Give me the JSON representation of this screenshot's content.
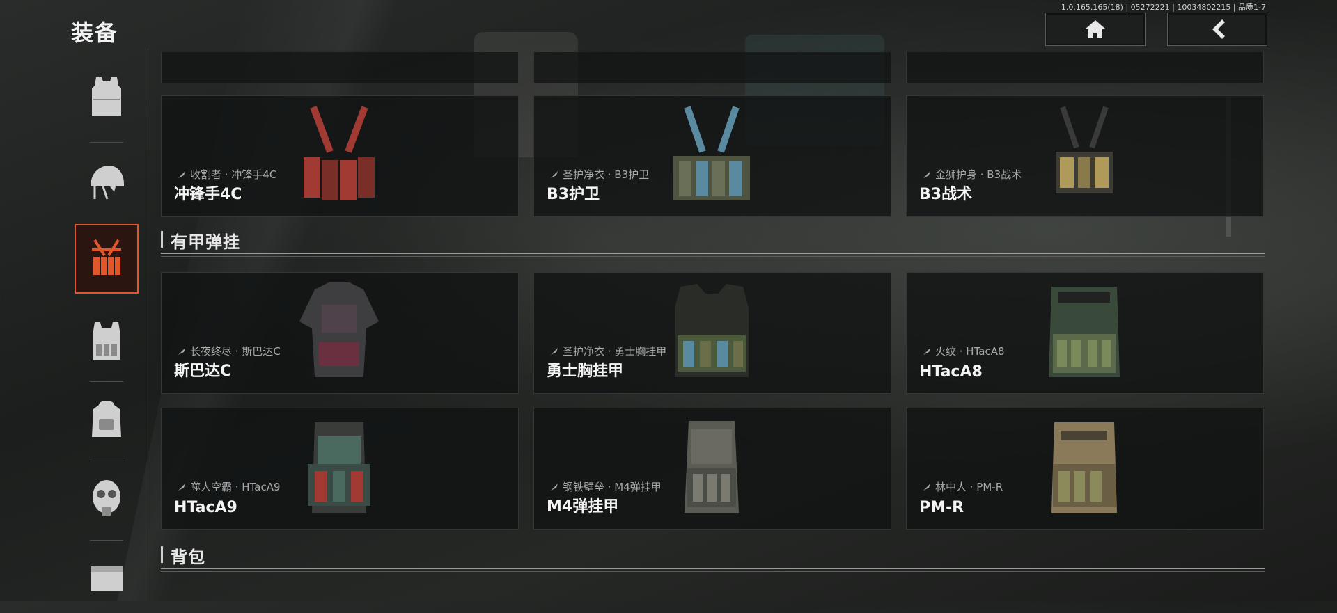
{
  "header": {
    "title": "装备",
    "version": "1.0.165.165(18) | 05272221 | 10034802215 | 品质1-7"
  },
  "nav": {
    "home_icon": "home-icon",
    "back_icon": "back-arrow-icon"
  },
  "side_rail": {
    "items": [
      {
        "icon": "body-armor-icon",
        "active": false
      },
      {
        "icon": "helmet-icon",
        "active": false
      },
      {
        "icon": "chest-rig-icon",
        "active": true
      },
      {
        "icon": "armored-rig-icon",
        "active": false
      },
      {
        "icon": "backpack-icon",
        "active": false
      },
      {
        "icon": "gas-mask-icon",
        "active": false
      },
      {
        "icon": "container-icon",
        "active": false
      }
    ],
    "accent_color": "#e1572c"
  },
  "chest_rigs": [
    {
      "sub": "收割者 · 冲锋手4C",
      "name": "冲锋手4C",
      "color": "#a03a32"
    },
    {
      "sub": "圣护净衣 · B3护卫",
      "name": "B3护卫",
      "color": "#5a8aa0"
    },
    {
      "sub": "金狮护身 · B3战术",
      "name": "B3战术",
      "color": "#b09a5a"
    }
  ],
  "armored_section": {
    "label": "有甲弹挂"
  },
  "armored_rigs": [
    {
      "sub": "长夜终尽 · 斯巴达C",
      "name": "斯巴达C",
      "color": "#6a3040"
    },
    {
      "sub": "圣护净衣 · 勇士胸挂甲",
      "name": "勇士胸挂甲",
      "color": "#4a5a3a"
    },
    {
      "sub": "火纹 · HTacA8",
      "name": "HTacA8",
      "color": "#5a6a4a"
    },
    {
      "sub": "噬人空霸 · HTacA9",
      "name": "HTacA9",
      "color": "#4a6a60"
    },
    {
      "sub": "钢铁壁垒 · M4弹挂甲",
      "name": "M4弹挂甲",
      "color": "#6a6a62"
    },
    {
      "sub": "林中人 · PM-R",
      "name": "PM-R",
      "color": "#8a7a5a"
    }
  ],
  "backpack_section": {
    "label": "背包"
  }
}
